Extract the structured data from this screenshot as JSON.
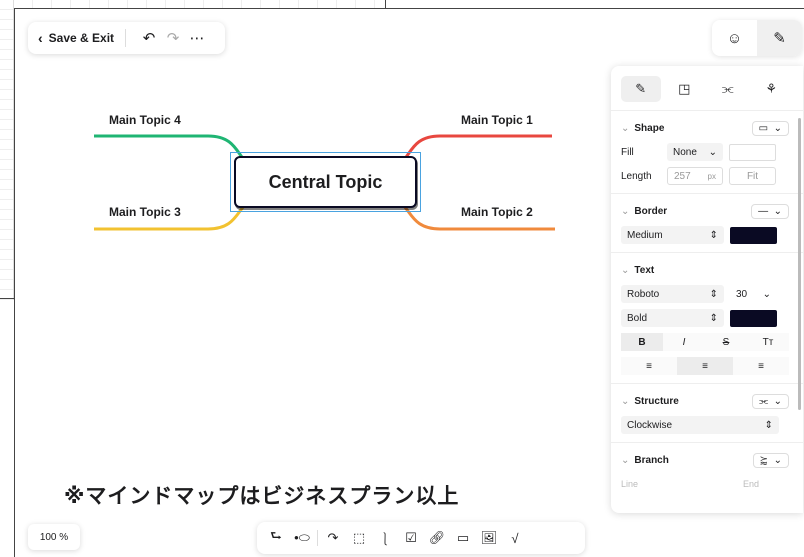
{
  "toolbar": {
    "save_label": "Save & Exit",
    "back_icon": "chevron-left-icon",
    "undo_icon": "undo-icon",
    "redo_icon": "redo-icon",
    "more_icon": "more-icon"
  },
  "top_right": {
    "emoji_icon": "emoji-icon",
    "style_icon": "paint-brush-icon"
  },
  "mindmap": {
    "central_topic": "Central Topic",
    "topics": [
      {
        "label": "Main Topic 1",
        "color": "#e8473f"
      },
      {
        "label": "Main Topic 2",
        "color": "#f08a3c"
      },
      {
        "label": "Main Topic 3",
        "color": "#f2c230"
      },
      {
        "label": "Main Topic 4",
        "color": "#1fb573"
      }
    ]
  },
  "panel": {
    "shape": {
      "title": "Shape",
      "fill_label": "Fill",
      "fill_value": "None",
      "length_label": "Length",
      "length_value": "257",
      "length_unit": "px",
      "fit_label": "Fit"
    },
    "border": {
      "title": "Border",
      "weight": "Medium",
      "color": "#0a0a23"
    },
    "text": {
      "title": "Text",
      "font": "Roboto",
      "size": "30",
      "weight": "Bold",
      "color": "#0a0a23",
      "bold_label": "B",
      "italic_label": "I",
      "strike_label": "S",
      "case_label": "Tт"
    },
    "structure": {
      "title": "Structure",
      "value": "Clockwise"
    },
    "branch": {
      "title": "Branch",
      "line_label": "Line",
      "end_label": "End"
    }
  },
  "note": "※マインドマップはビジネスプラン以上",
  "zoom": "100 %"
}
